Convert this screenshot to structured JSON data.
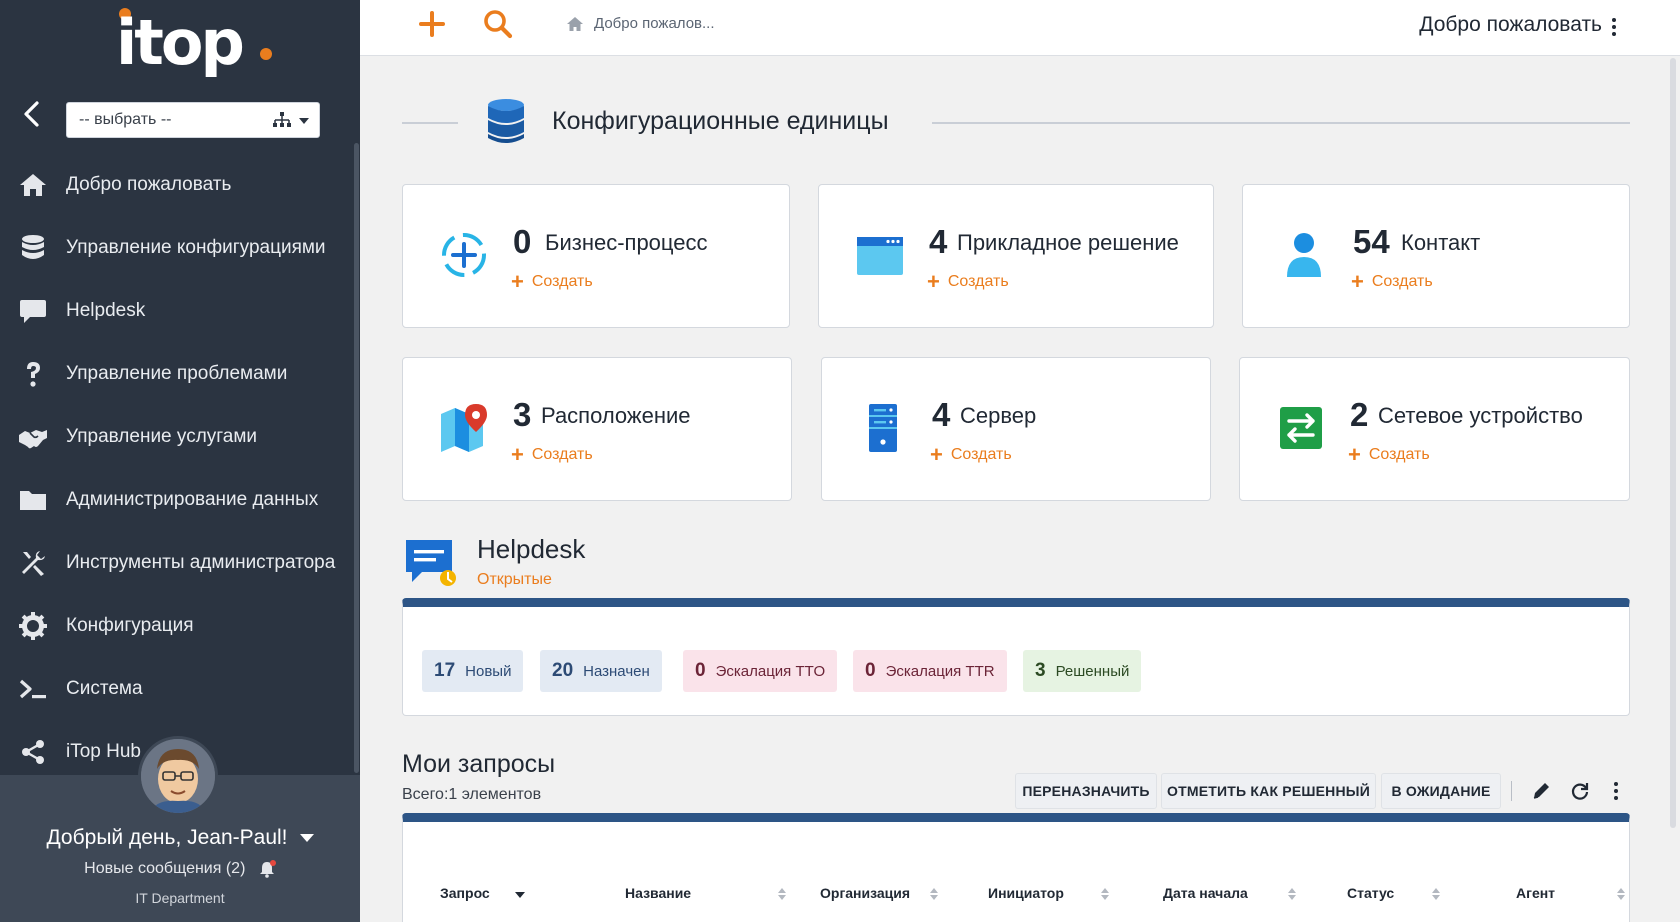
{
  "sidebar": {
    "logo_text": "itop",
    "org_select": {
      "value": "-- выбрать --"
    },
    "menu": [
      {
        "label": "Добро пожаловать",
        "icon": "home-icon"
      },
      {
        "label": "Управление конфигурациями",
        "icon": "database-icon"
      },
      {
        "label": "Helpdesk",
        "icon": "chat-bubble-icon"
      },
      {
        "label": "Управление проблемами",
        "icon": "question-icon"
      },
      {
        "label": "Управление услугами",
        "icon": "handshake-icon"
      },
      {
        "label": "Администрирование данных",
        "icon": "folder-icon"
      },
      {
        "label": "Инструменты администратора",
        "icon": "tools-icon"
      },
      {
        "label": "Конфигурация",
        "icon": "gear-icon"
      },
      {
        "label": "Система",
        "icon": "terminal-icon"
      },
      {
        "label": "iTop Hub",
        "icon": "share-icon"
      }
    ],
    "user": {
      "greeting": "Добрый день, Jean-Paul!",
      "messages": "Новые сообщения (2)",
      "department": "IT Department"
    }
  },
  "topbar": {
    "breadcrumb": "Добро пожалов...",
    "page_title": "Добро пожаловать"
  },
  "ci_section": {
    "title": "Конфигурационные единицы",
    "create_label": "Создать",
    "cards": [
      {
        "count": "0",
        "name": "Бизнес-процесс",
        "icon": "business-process-icon"
      },
      {
        "count": "4",
        "name": "Прикладное решение",
        "icon": "application-window-icon"
      },
      {
        "count": "54",
        "name": "Контакт",
        "icon": "person-icon"
      },
      {
        "count": "3",
        "name": "Расположение",
        "icon": "map-pin-icon"
      },
      {
        "count": "4",
        "name": "Сервер",
        "icon": "server-icon"
      },
      {
        "count": "2",
        "name": "Сетевое устройство",
        "icon": "network-switch-icon"
      }
    ]
  },
  "helpdesk": {
    "title": "Helpdesk",
    "subtitle": "Открытые",
    "badges": [
      {
        "count": "17",
        "label": "Новый",
        "bg": "#e3eaf3"
      },
      {
        "count": "20",
        "label": "Назначен",
        "bg": "#e3eaf3"
      },
      {
        "count": "0",
        "label": "Эскалация TTO",
        "bg": "#fae3ea"
      },
      {
        "count": "0",
        "label": "Эскалация TTR",
        "bg": "#fae3ea"
      },
      {
        "count": "3",
        "label": "Решенный",
        "bg": "#e6f3e2"
      }
    ]
  },
  "my_requests": {
    "title": "Мои запросы",
    "total": "Всего:1 элементов",
    "buttons": [
      "ПЕРЕНАЗНАЧИТЬ",
      "ОТМЕТИТЬ КАК РЕШЕННЫЙ",
      "В ОЖИДАНИЕ"
    ],
    "columns": [
      "Запрос",
      "Название",
      "Организация",
      "Инициатор",
      "Дата начала",
      "Статус",
      "Агент"
    ]
  },
  "colors": {
    "sidebar_bg": "#2b3441",
    "accent_orange": "#ea7d1e",
    "panel_header_blue": "#2d5586"
  }
}
